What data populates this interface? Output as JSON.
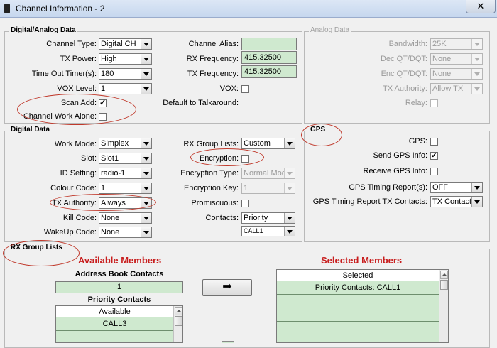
{
  "window": {
    "title": "Channel Information - 2",
    "close_glyph": "✕"
  },
  "digital_analog": {
    "title": "Digital/Analog Data",
    "channel_type": {
      "label": "Channel Type:",
      "value": "Digital CH"
    },
    "tx_power": {
      "label": "TX Power:",
      "value": "High"
    },
    "time_out_timer": {
      "label": "Time Out Timer(s):",
      "value": "180"
    },
    "vox_level": {
      "label": "VOX Level:",
      "value": "1"
    },
    "scan_add": {
      "label": "Scan Add:",
      "checked": true
    },
    "channel_work_alone": {
      "label": "Channel Work Alone:",
      "checked": false
    },
    "channel_alias": {
      "label": "Channel Alias:",
      "value": ""
    },
    "rx_frequency": {
      "label": "RX Frequency:",
      "value": "415.32500"
    },
    "tx_frequency": {
      "label": "TX Frequency:",
      "value": "415.32500"
    },
    "vox": {
      "label": "VOX:",
      "checked": false
    },
    "default_talkaround": {
      "label": "Default to Talkaround:"
    }
  },
  "analog": {
    "title": "Analog Data",
    "bandwidth": {
      "label": "Bandwidth:",
      "value": "25K"
    },
    "dec_qt": {
      "label": "Dec QT/DQT:",
      "value": "None"
    },
    "enc_qt": {
      "label": "Enc QT/DQT:",
      "value": "None"
    },
    "tx_authority": {
      "label": "TX Authority:",
      "value": "Allow TX"
    },
    "relay": {
      "label": "Relay:",
      "checked": false
    }
  },
  "digital": {
    "title": "Digital Data",
    "work_mode": {
      "label": "Work Mode:",
      "value": "Simplex"
    },
    "slot": {
      "label": "Slot:",
      "value": "Slot1"
    },
    "id_setting": {
      "label": "ID Setting:",
      "value": "radio-1"
    },
    "colour_code": {
      "label": "Colour Code:",
      "value": "1"
    },
    "tx_authority": {
      "label": "TX Authority:",
      "value": "Always"
    },
    "kill_code": {
      "label": "Kill Code:",
      "value": "None"
    },
    "wakeup_code": {
      "label": "WakeUp Code:",
      "value": "None"
    },
    "rx_group_lists": {
      "label": "RX Group Lists:",
      "value": "Custom"
    },
    "encryption": {
      "label": "Encryption:",
      "checked": false
    },
    "encryption_type": {
      "label": "Encryption Type:",
      "value": "Normal Mod"
    },
    "encryption_key": {
      "label": "Encryption Key:",
      "value": "1"
    },
    "promiscuous": {
      "label": "Promiscuous:",
      "checked": false
    },
    "contacts": {
      "label": "Contacts:",
      "value": "Priority",
      "value2": "CALL1"
    }
  },
  "gps": {
    "title": "GPS",
    "gps": {
      "label": "GPS:",
      "checked": false
    },
    "send_gps_info": {
      "label": "Send GPS Info:",
      "checked": true
    },
    "receive_gps_info": {
      "label": "Receive GPS Info:",
      "checked": false
    },
    "timing_report": {
      "label": "GPS Timing Report(s):",
      "value": "OFF"
    },
    "timing_report_tx_contacts": {
      "label": "GPS Timing Report TX Contacts:",
      "value": "TX Contact"
    }
  },
  "rx_group": {
    "title": "RX Group Lists",
    "available_heading": "Available Members",
    "selected_heading": "Selected Members",
    "address_book_label": "Address Book Contacts",
    "address_book_value": "1",
    "priority_label": "Priority Contacts",
    "available_list_header": "Available",
    "available_items": [
      "CALL3",
      ""
    ],
    "selected_list_header": "Selected",
    "selected_items": [
      "Priority Contacts: CALL1",
      "",
      "",
      "",
      ""
    ],
    "move_right_glyph": "➡"
  },
  "colors": {
    "accent_red": "#c81e1e",
    "field_green": "#cfe9cf",
    "annotation_red": "#c0392b"
  }
}
